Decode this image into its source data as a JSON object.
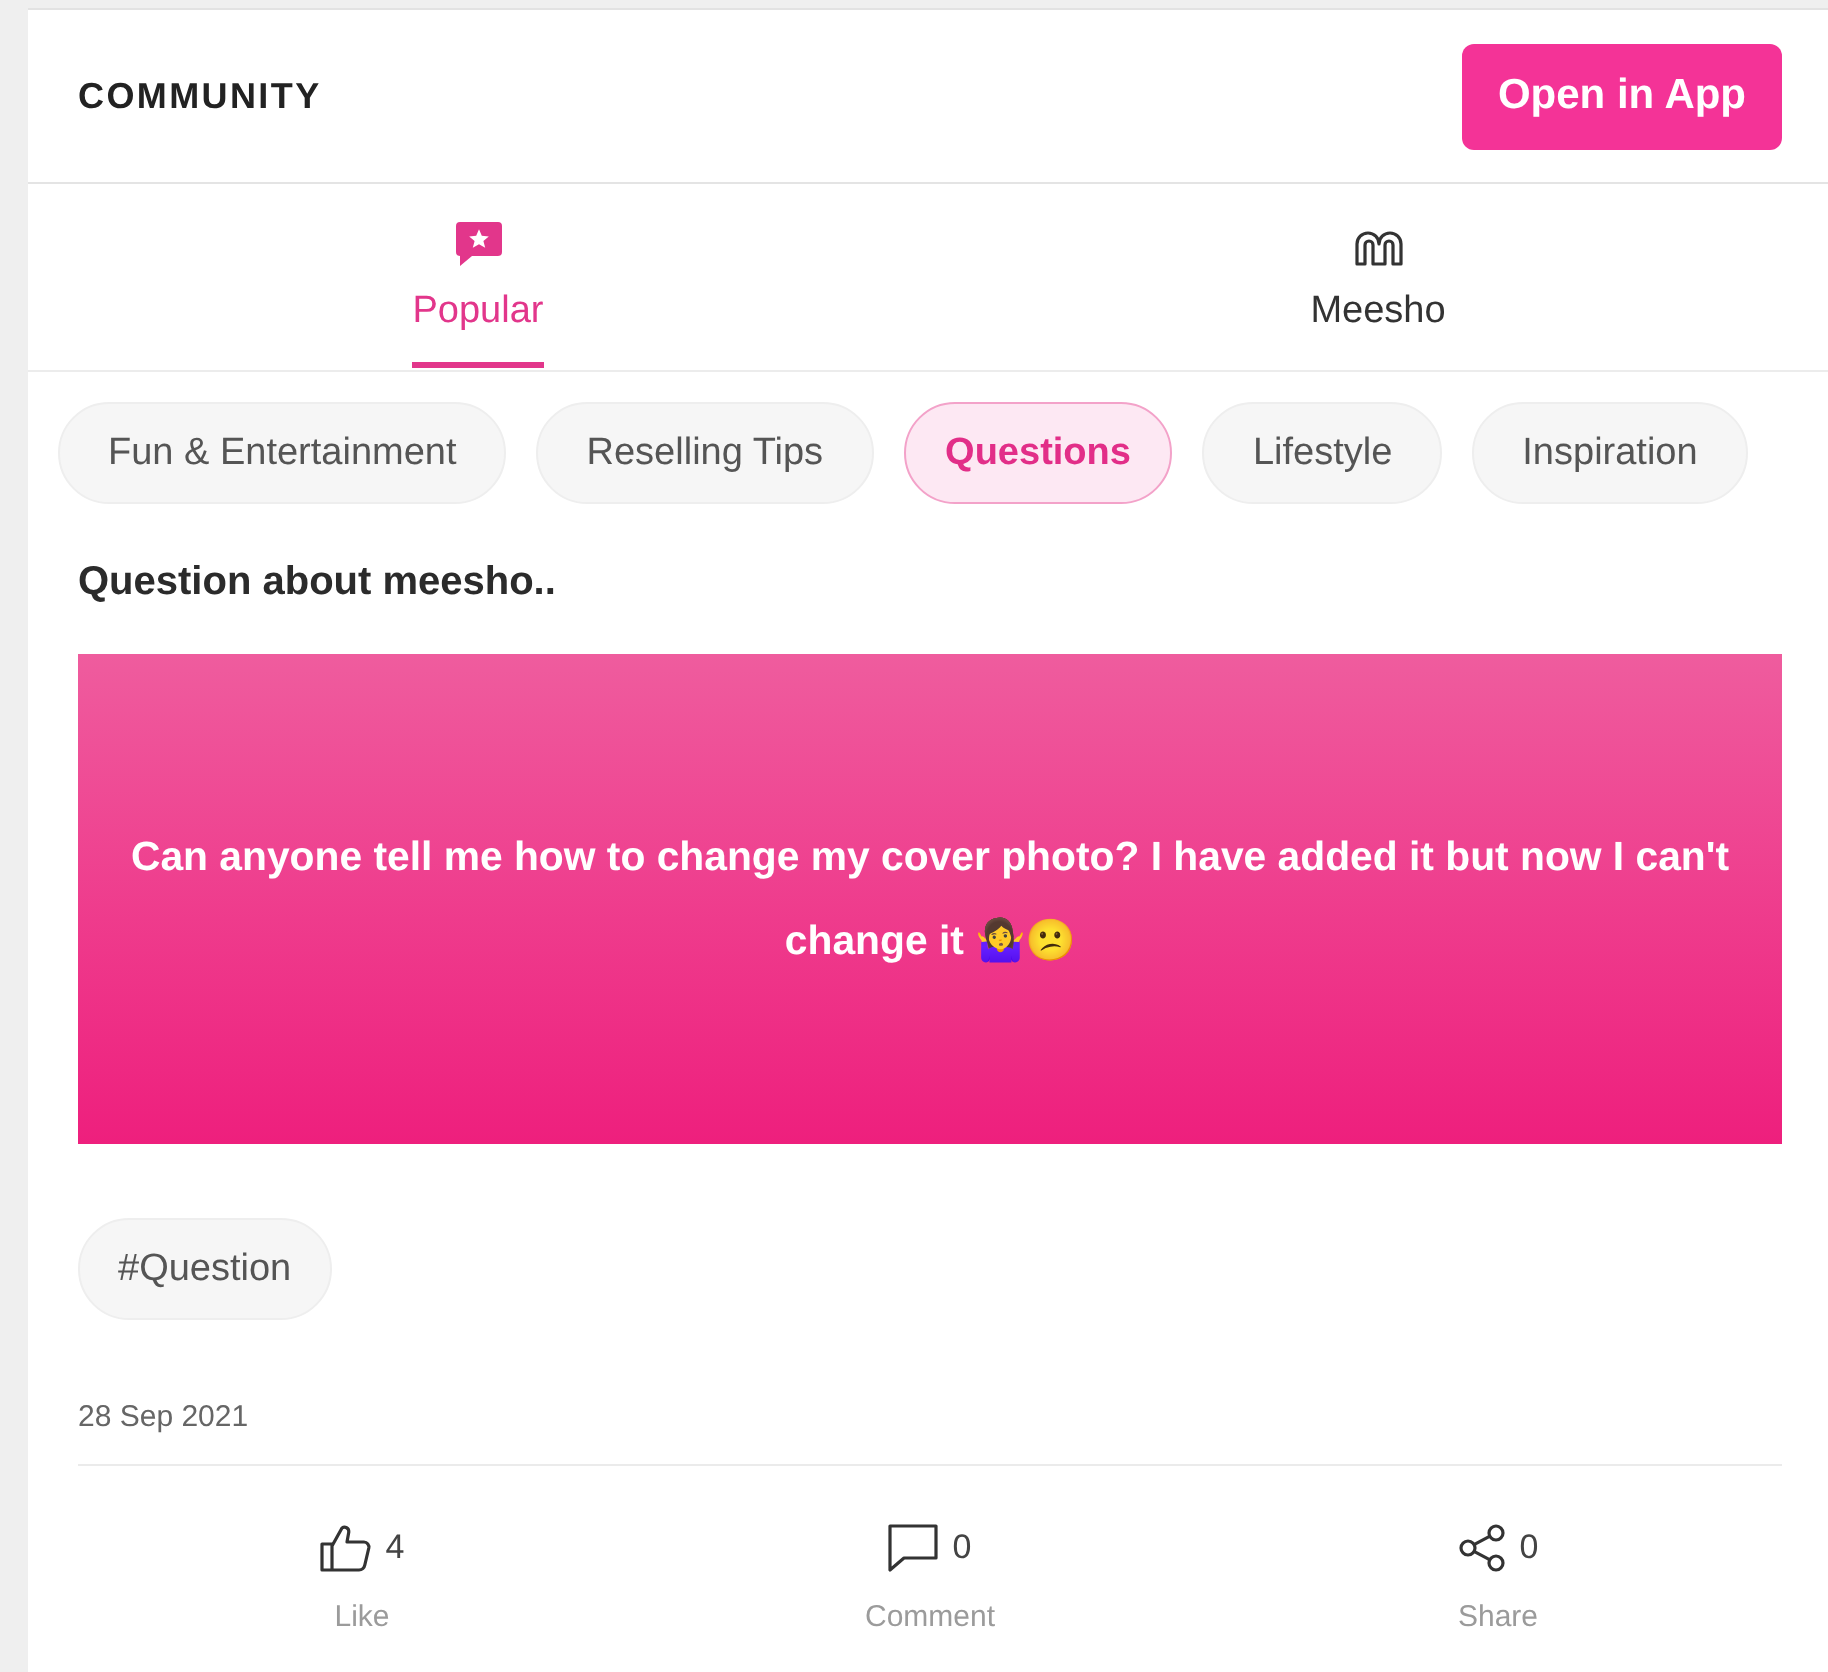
{
  "header": {
    "title": "COMMUNITY",
    "open_button": "Open in App"
  },
  "tabs": [
    {
      "kind": "popular",
      "label": "Popular",
      "selected": true
    },
    {
      "kind": "brand",
      "label": "Meesho",
      "selected": false
    }
  ],
  "categories": [
    {
      "label": "Fun & Entertainment",
      "selected": false
    },
    {
      "label": "Reselling Tips",
      "selected": false
    },
    {
      "label": "Questions",
      "selected": true
    },
    {
      "label": "Lifestyle",
      "selected": false
    },
    {
      "label": "Inspiration",
      "selected": false
    }
  ],
  "post": {
    "title": "Question about meesho..",
    "body": "Can anyone tell me how to change my cover photo? I have added it but now I can't change it 🤷‍♀️😕",
    "hashtags": [
      "#Question"
    ],
    "date": "28 Sep 2021"
  },
  "actions": [
    {
      "kind": "like",
      "count": "4",
      "label": "Like"
    },
    {
      "kind": "comment",
      "count": "0",
      "label": "Comment"
    },
    {
      "kind": "share",
      "count": "0",
      "label": "Share"
    }
  ]
}
